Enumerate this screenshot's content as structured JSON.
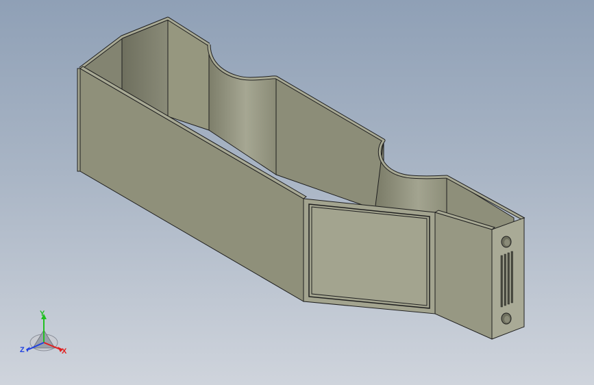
{
  "viewport": {
    "background_top": "#8fa0b6",
    "background_bottom": "#cfd4dc"
  },
  "model": {
    "part_color": "#8f907a",
    "inner_color": "#9a9b86",
    "edge_color": "#1e1e1e",
    "features": [
      "open-box-body",
      "semicircular-cutouts",
      "rectangular-window",
      "mounting-holes",
      "vent-slots"
    ]
  },
  "triad": {
    "x_label": "X",
    "y_label": "Y",
    "z_label": "Z",
    "x_color": "#e02020",
    "y_color": "#20c020",
    "z_color": "#2040e0"
  }
}
